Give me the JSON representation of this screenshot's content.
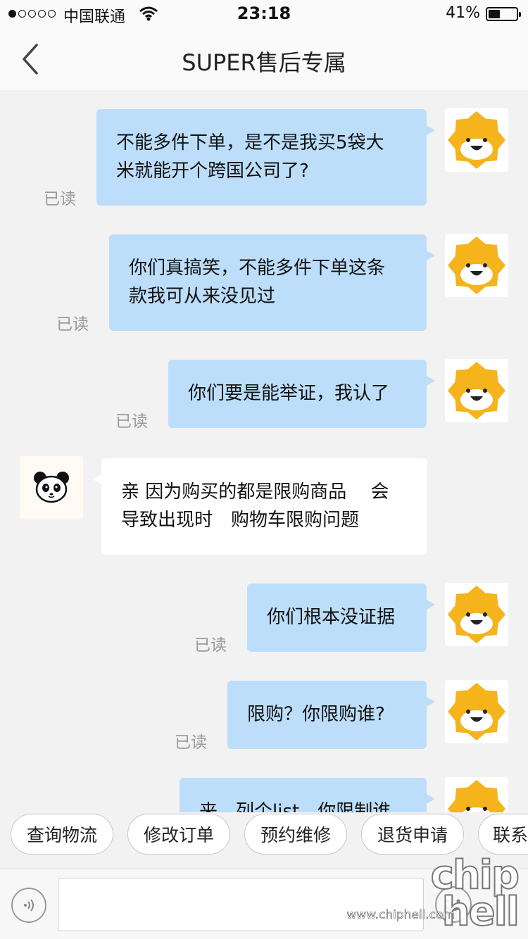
{
  "status_bar": {
    "signal_dots_filled": 1,
    "signal_dots_total": 5,
    "carrier": "中国联通",
    "time": "23:18",
    "battery_percent_text": "41%",
    "battery_level": 0.41
  },
  "navbar": {
    "title": "SUPER售后专属",
    "back_icon": "chevron-left-icon"
  },
  "messages": [
    {
      "sender": "me",
      "lines": [
        "不能多件下单，是不是我买5袋大",
        "米就能开个跨国公司了?"
      ],
      "status": "已读"
    },
    {
      "sender": "me",
      "lines": [
        "你们真搞笑，不能多件下单这条",
        "款我可从来没见过"
      ],
      "status": "已读"
    },
    {
      "sender": "me",
      "lines": [
        "你们要是能举证，我认了"
      ],
      "status": "已读"
    },
    {
      "sender": "agent",
      "lines": [
        "亲 因为购买的都是限购商品　 会",
        "导致出现时　购物车限购问题"
      ]
    },
    {
      "sender": "me",
      "lines": [
        "你们根本没证据"
      ],
      "status": "已读"
    },
    {
      "sender": "me",
      "lines": [
        "限购？你限购谁?"
      ],
      "status": "已读"
    },
    {
      "sender": "me",
      "lines": [
        "来，列个list，你限制谁"
      ]
    }
  ],
  "quick_replies": [
    "查询物流",
    "修改订单",
    "预约维修",
    "退货申请",
    "联系"
  ],
  "input_bar": {
    "voice_icon": "voice-icon",
    "emoji_icon": "emoji-icon"
  },
  "watermark": {
    "logo": "chip hell",
    "url": "www.chiphell.com"
  },
  "colors": {
    "my_bubble": "#bcdefa",
    "agent_bubble": "#ffffff",
    "background": "#f2f2f2",
    "lion_avatar": "#f5b31c"
  }
}
